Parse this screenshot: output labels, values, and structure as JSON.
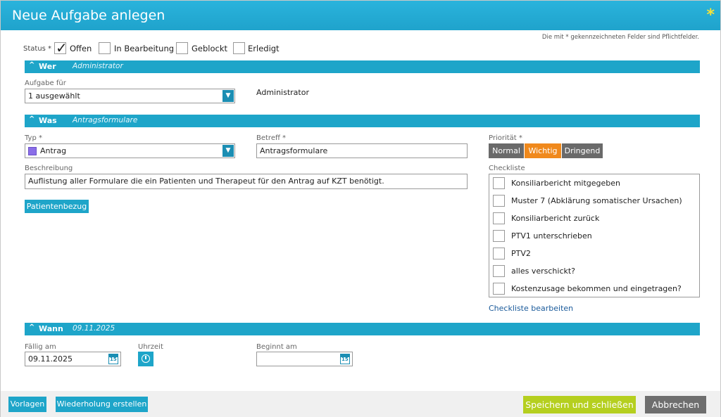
{
  "dialog": {
    "title": "Neue Aufgabe anlegen",
    "required_marker": "*",
    "required_note": "Die mit * gekennzeichneten Felder sind Pflichtfelder."
  },
  "status": {
    "label": "Status *",
    "options": [
      {
        "label": "Offen",
        "checked": true
      },
      {
        "label": "In Bearbeitung",
        "checked": false
      },
      {
        "label": "Geblockt",
        "checked": false
      },
      {
        "label": "Erledigt",
        "checked": false
      }
    ]
  },
  "wer": {
    "section_title": "Wer",
    "section_sub": "Administrator",
    "aufgabe_fuer_label": "Aufgabe für",
    "aufgabe_fuer_value": "1 ausgewählt",
    "assignee": "Administrator"
  },
  "was": {
    "section_title": "Was",
    "section_sub": "Antragsformulare",
    "typ_label": "Typ *",
    "typ_value": "Antrag",
    "typ_color": "#8a6ee8",
    "betreff_label": "Betreff *",
    "betreff_value": "Antragsformulare",
    "beschreibung_label": "Beschreibung",
    "beschreibung_value": "Auflistung aller Formulare die ein Patienten und Therapeut für den Antrag auf KZT benötigt.",
    "patientenbezug_button": "Patientenbezug",
    "prioritaet_label": "Priorität *",
    "prioritaet_options": [
      "Normal",
      "Wichtig",
      "Dringend"
    ],
    "prioritaet_selected": "Wichtig",
    "checkliste_label": "Checkliste",
    "checklist": [
      "Konsiliarbericht mitgegeben",
      "Muster 7 (Abklärung somatischer Ursachen)",
      "Konsiliarbericht zurück",
      "PTV1 unterschrieben",
      "PTV2",
      "alles verschickt?",
      "Kostenzusage bekommen und eingetragen?"
    ],
    "checkliste_edit_link": "Checkliste bearbeiten"
  },
  "wann": {
    "section_title": "Wann",
    "section_sub": "09.11.2025",
    "faellig_label": "Fällig am",
    "faellig_value": "09.11.2025",
    "uhrzeit_label": "Uhrzeit",
    "beginnt_label": "Beginnt am",
    "beginnt_value": "",
    "calendar_day": "15"
  },
  "footer": {
    "vorlagen": "Vorlagen",
    "wiederholung": "Wiederholung erstellen",
    "speichern": "Speichern und schließen",
    "abbrechen": "Abbrechen"
  },
  "colors": {
    "accent": "#1ea5c9",
    "save": "#b5cf1f",
    "cancel": "#6e6e6e",
    "priority_selected": "#f0891c",
    "priority_default": "#6a6a6a"
  }
}
